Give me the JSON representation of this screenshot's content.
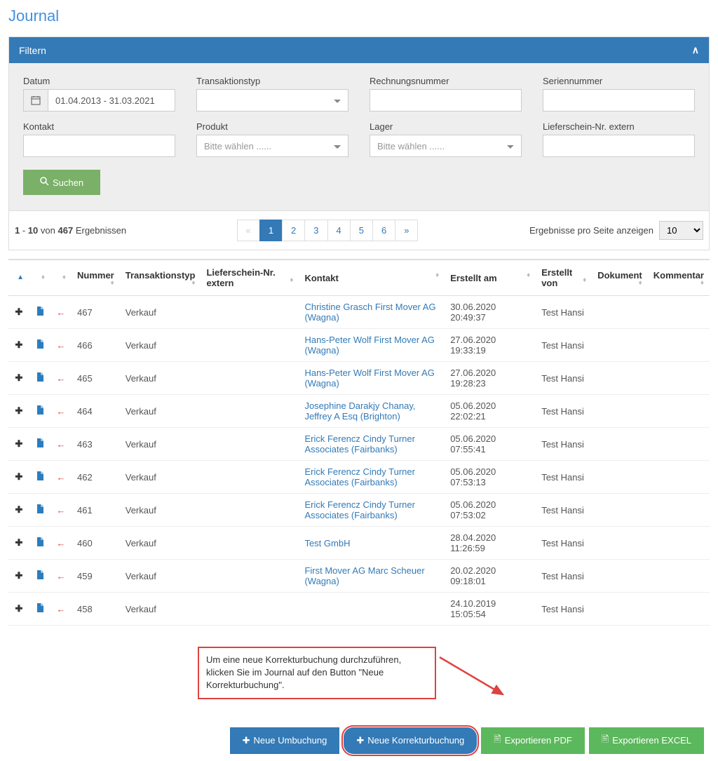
{
  "page_title": "Journal",
  "filter": {
    "panel_title": "Filtern",
    "datum_label": "Datum",
    "datum_value": "01.04.2013 - 31.03.2021",
    "transtyp_label": "Transaktionstyp",
    "rechnr_label": "Rechnungsnummer",
    "seriennr_label": "Seriennummer",
    "kontakt_label": "Kontakt",
    "produkt_label": "Produkt",
    "produkt_placeholder": "Bitte wählen ......",
    "lager_label": "Lager",
    "lager_placeholder": "Bitte wählen ......",
    "lieferschein_label": "Lieferschein-Nr. extern",
    "search_btn": "Suchen"
  },
  "results": {
    "from": "1",
    "to": "10",
    "of_word": "von",
    "total": "467",
    "results_word": "Ergebnissen",
    "pages": [
      "«",
      "1",
      "2",
      "3",
      "4",
      "5",
      "6",
      "»"
    ],
    "active_page": "1",
    "per_page_label": "Ergebnisse pro Seite anzeigen",
    "per_page_value": "10"
  },
  "table": {
    "headers": {
      "nummer": "Nummer",
      "transtyp": "Transaktionstyp",
      "lieferschein": "Lieferschein-Nr. extern",
      "kontakt": "Kontakt",
      "erstellt_am": "Erstellt am",
      "erstellt_von": "Erstellt von",
      "dokument": "Dokument",
      "kommentar": "Kommentar"
    },
    "rows": [
      {
        "nummer": "467",
        "typ": "Verkauf",
        "ls": "",
        "kontakt": "Christine Grasch First Mover AG (Wagna)",
        "am": "30.06.2020 20:49:37",
        "von": "Test Hansi"
      },
      {
        "nummer": "466",
        "typ": "Verkauf",
        "ls": "",
        "kontakt": "Hans-Peter Wolf First Mover AG (Wagna)",
        "am": "27.06.2020 19:33:19",
        "von": "Test Hansi"
      },
      {
        "nummer": "465",
        "typ": "Verkauf",
        "ls": "",
        "kontakt": "Hans-Peter Wolf First Mover AG (Wagna)",
        "am": "27.06.2020 19:28:23",
        "von": "Test Hansi"
      },
      {
        "nummer": "464",
        "typ": "Verkauf",
        "ls": "",
        "kontakt": "Josephine Darakjy Chanay, Jeffrey A Esq (Brighton)",
        "am": "05.06.2020 22:02:21",
        "von": "Test Hansi"
      },
      {
        "nummer": "463",
        "typ": "Verkauf",
        "ls": "",
        "kontakt": "Erick Ferencz Cindy Turner Associates (Fairbanks)",
        "am": "05.06.2020 07:55:41",
        "von": "Test Hansi"
      },
      {
        "nummer": "462",
        "typ": "Verkauf",
        "ls": "",
        "kontakt": "Erick Ferencz Cindy Turner Associates (Fairbanks)",
        "am": "05.06.2020 07:53:13",
        "von": "Test Hansi"
      },
      {
        "nummer": "461",
        "typ": "Verkauf",
        "ls": "",
        "kontakt": "Erick Ferencz Cindy Turner Associates (Fairbanks)",
        "am": "05.06.2020 07:53:02",
        "von": "Test Hansi"
      },
      {
        "nummer": "460",
        "typ": "Verkauf",
        "ls": "",
        "kontakt": "Test GmbH",
        "am": "28.04.2020 11:26:59",
        "von": "Test Hansi"
      },
      {
        "nummer": "459",
        "typ": "Verkauf",
        "ls": "",
        "kontakt": "First Mover AG Marc Scheuer (Wagna)",
        "am": "20.02.2020 09:18:01",
        "von": "Test Hansi"
      },
      {
        "nummer": "458",
        "typ": "Verkauf",
        "ls": "",
        "kontakt": "",
        "am": "24.10.2019 15:05:54",
        "von": "Test Hansi"
      }
    ]
  },
  "annotation": {
    "text": "Um eine neue Korrekturbuchung durchzuführen, klicken Sie im Journal auf den Button \"Neue Korrekturbuchung\"."
  },
  "buttons": {
    "neue_umbuchung": "Neue Umbuchung",
    "neue_korrektur": "Neue Korrekturbuchung",
    "export_pdf": "Exportieren PDF",
    "export_excel": "Exportieren EXCEL"
  }
}
